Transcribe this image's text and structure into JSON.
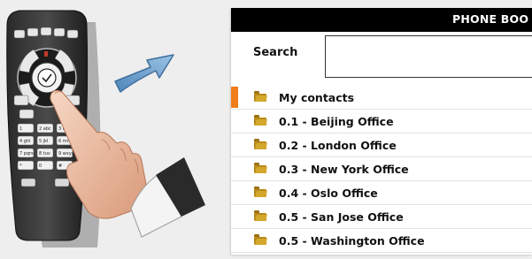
{
  "phonebook": {
    "title": "PHONE BOO",
    "search_label": "Search",
    "search_value": "",
    "items": [
      {
        "label": "My contacts",
        "selected": true
      },
      {
        "label": "0.1 - Beijing Office",
        "selected": false
      },
      {
        "label": "0.2 - London Office",
        "selected": false
      },
      {
        "label": "0.3 - New York Office",
        "selected": false
      },
      {
        "label": "0.4 - Oslo Office",
        "selected": false
      },
      {
        "label": "0.5 - San Jose Office",
        "selected": false
      },
      {
        "label": "0.5 - Washington Office",
        "selected": false
      }
    ],
    "accent_color": "#f07c1a",
    "folder_color": "#d4a82c",
    "header_color": "#000000"
  },
  "illustration": {
    "remote_key_labels": [
      "1",
      "2 abc",
      "3 def",
      "4 ghi",
      "5 jkl",
      "6 mno",
      "7 pqrs",
      "8 tuv",
      "9 wxyz",
      "*",
      "0",
      "#"
    ],
    "arrow_color": "#6fa3cf",
    "icons": [
      "remote-control-icon",
      "hand-icon",
      "arrow-icon",
      "folder-icon",
      "ok-icon"
    ]
  }
}
